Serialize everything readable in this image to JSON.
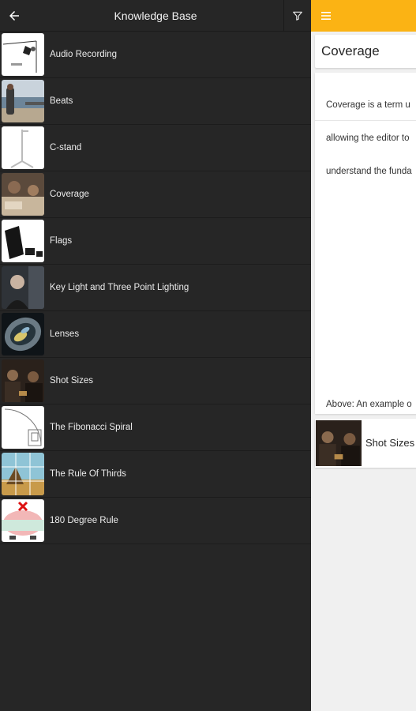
{
  "header": {
    "title": "Knowledge Base",
    "back_icon": "arrow-left-icon",
    "filter_icon": "filter-icon"
  },
  "items": [
    {
      "label": "Audio Recording"
    },
    {
      "label": "Beats"
    },
    {
      "label": "C-stand"
    },
    {
      "label": "Coverage"
    },
    {
      "label": "Flags"
    },
    {
      "label": "Key Light and Three Point Lighting"
    },
    {
      "label": "Lenses"
    },
    {
      "label": "Shot Sizes"
    },
    {
      "label": "The Fibonacci Spiral"
    },
    {
      "label": "The Rule Of Thirds"
    },
    {
      "label": "180 Degree Rule"
    }
  ],
  "detail": {
    "menu_icon": "menu-icon",
    "title": "Coverage",
    "body_lines": [
      "Coverage is a term u",
      "allowing the editor to",
      "understand the funda"
    ],
    "caption": "Above: An example o",
    "related_label": "Shot Sizes"
  },
  "colors": {
    "background": "#262626",
    "accent": "#fbb314",
    "detail_background": "#f0f0f0"
  }
}
